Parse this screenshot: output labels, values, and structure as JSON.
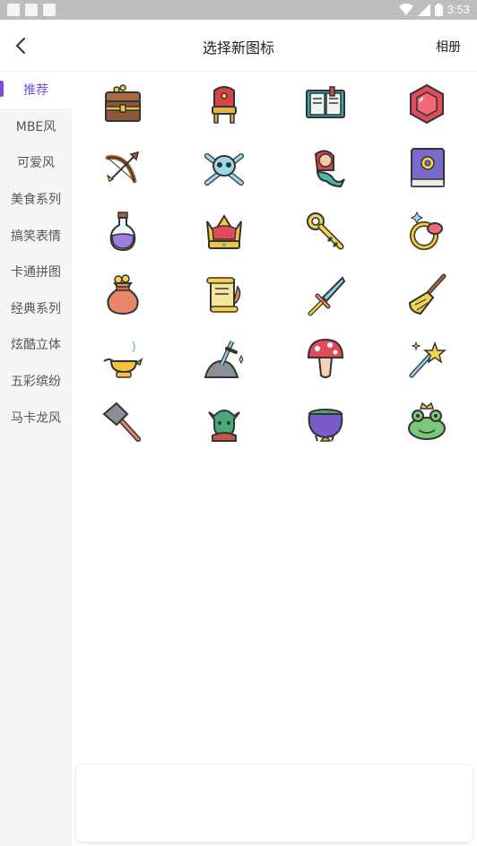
{
  "status_bar": {
    "time": "3:53"
  },
  "header": {
    "title": "选择新图标",
    "right_action": "相册"
  },
  "sidebar": {
    "items": [
      {
        "label": "推荐",
        "active": true
      },
      {
        "label": "MBE风"
      },
      {
        "label": "可爱风"
      },
      {
        "label": "美食系列"
      },
      {
        "label": "搞笑表情"
      },
      {
        "label": "卡通拼图"
      },
      {
        "label": "经典系列"
      },
      {
        "label": "炫酷立体"
      },
      {
        "label": "五彩缤纷"
      },
      {
        "label": "马卡龙风"
      }
    ]
  },
  "icons": [
    "treasure-chest-icon",
    "throne-icon",
    "spell-book-icon",
    "gem-icon",
    "bow-arrow-icon",
    "skull-crossbones-icon",
    "mermaid-icon",
    "magic-book-icon",
    "potion-icon",
    "crown-icon",
    "key-icon",
    "ring-icon",
    "gold-bag-icon",
    "scroll-icon",
    "sword-icon",
    "broom-icon",
    "magic-lamp-icon",
    "sword-in-stone-icon",
    "mushroom-icon",
    "magic-wand-icon",
    "war-hammer-icon",
    "goblin-icon",
    "cauldron-icon",
    "frog-prince-icon"
  ],
  "colors": {
    "accent": "#7b4be3",
    "outline": "#333333"
  }
}
